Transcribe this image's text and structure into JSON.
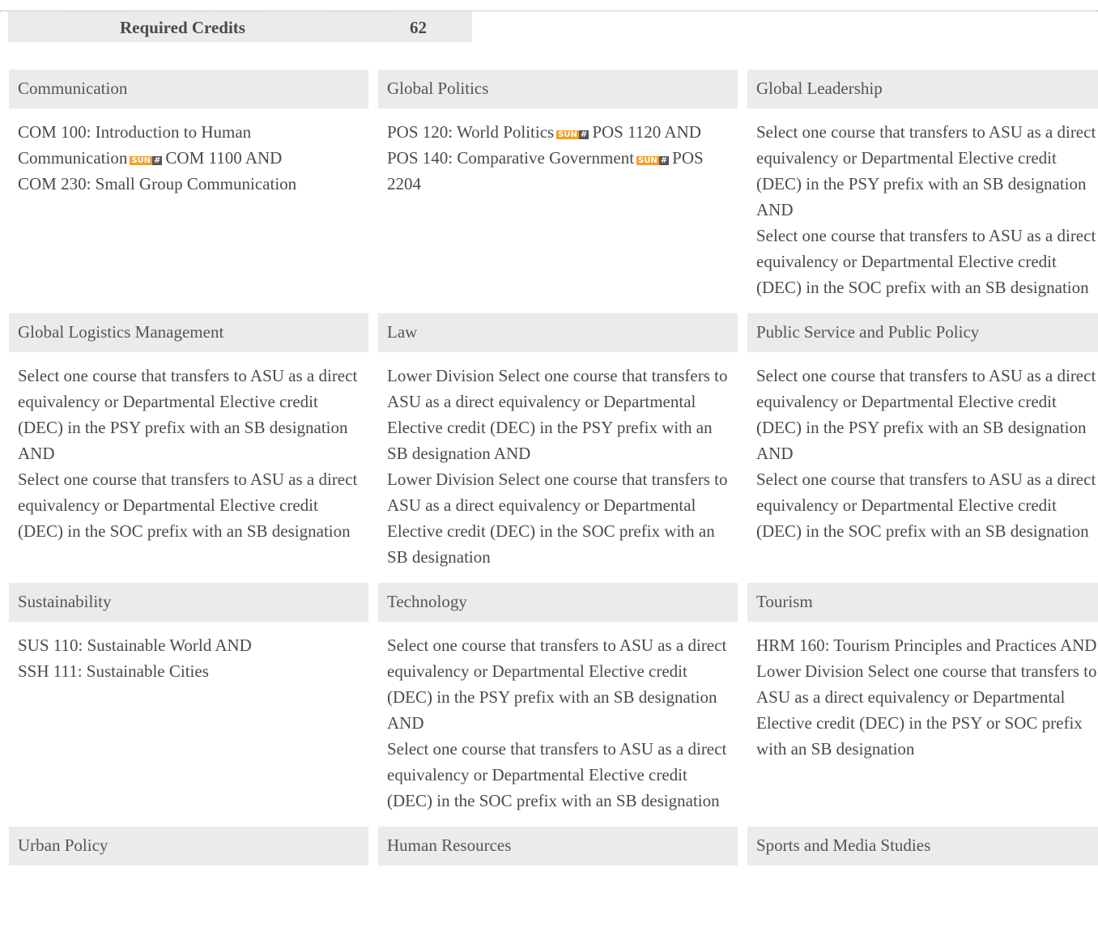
{
  "required_credits": {
    "label": "Required Credits",
    "value": "62"
  },
  "sun_badge": {
    "left": "SUN",
    "right": "#",
    "color_left": "#f0a030",
    "color_right": "#555555"
  },
  "cards": [
    {
      "title": "Communication",
      "lines": [
        {
          "pre": "COM 100: Introduction to Human Communication",
          "badge": true,
          "post": "COM 1100 AND"
        },
        {
          "text": "COM 230: Small Group Communication"
        }
      ]
    },
    {
      "title": "Global Politics",
      "lines": [
        {
          "pre": "POS 120: World Politics",
          "badge": true,
          "post": "POS 1120 AND"
        },
        {
          "pre": "POS 140: Comparative Government",
          "badge": true,
          "post": "POS 2204"
        }
      ]
    },
    {
      "title": "Global Leadership",
      "lines": [
        {
          "text": "Select one course that transfers to ASU as a direct equivalency or Departmental Elective credit (DEC) in the PSY prefix with an SB designation AND"
        },
        {
          "text": "Select one course that transfers to ASU as a direct equivalency or Departmental Elective credit (DEC) in the SOC prefix with an SB designation"
        }
      ]
    },
    {
      "title": "Global Logistics Management",
      "lines": [
        {
          "text": "Select one course that transfers to ASU as a direct equivalency or Departmental Elective credit (DEC) in the PSY prefix with an SB designation AND"
        },
        {
          "text": "Select one course that transfers to ASU as a direct equivalency or Departmental Elective credit (DEC) in the SOC prefix with an SB designation"
        }
      ]
    },
    {
      "title": "Law",
      "lines": [
        {
          "text": "Lower Division Select one course that transfers to ASU as a direct equivalency or Departmental Elective credit (DEC) in the PSY prefix with an SB designation AND"
        },
        {
          "text": "Lower Division Select one course that transfers to ASU as a direct equivalency or Departmental Elective credit (DEC) in the SOC prefix with an SB designation"
        }
      ]
    },
    {
      "title": "Public Service and Public Policy",
      "lines": [
        {
          "text": "Select one course that transfers to ASU as a direct equivalency or Departmental Elective credit (DEC) in the PSY prefix with an SB designation AND"
        },
        {
          "text": "Select one course that transfers to ASU as a direct equivalency or Departmental Elective credit (DEC) in the SOC prefix with an SB designation"
        }
      ]
    },
    {
      "title": "Sustainability",
      "lines": [
        {
          "text": "SUS 110: Sustainable World AND"
        },
        {
          "text": "SSH 111: Sustainable Cities"
        }
      ]
    },
    {
      "title": "Technology",
      "lines": [
        {
          "text": "Select one course that transfers to ASU as a direct equivalency or Departmental Elective credit (DEC) in the PSY prefix with an SB designation AND"
        },
        {
          "text": "Select one course that transfers to ASU as a direct equivalency or Departmental Elective credit (DEC) in the SOC prefix with an SB designation"
        }
      ]
    },
    {
      "title": "Tourism",
      "lines": [
        {
          "text": "HRM 160: Tourism Principles and Practices AND"
        },
        {
          "text": "Lower Division Select one course that transfers to ASU as a direct equivalency or Departmental Elective credit (DEC) in the PSY or SOC prefix with an SB designation"
        }
      ]
    },
    {
      "title": "Urban Policy",
      "lines": []
    },
    {
      "title": "Human Resources",
      "lines": []
    },
    {
      "title": "Sports and Media Studies",
      "lines": []
    }
  ]
}
